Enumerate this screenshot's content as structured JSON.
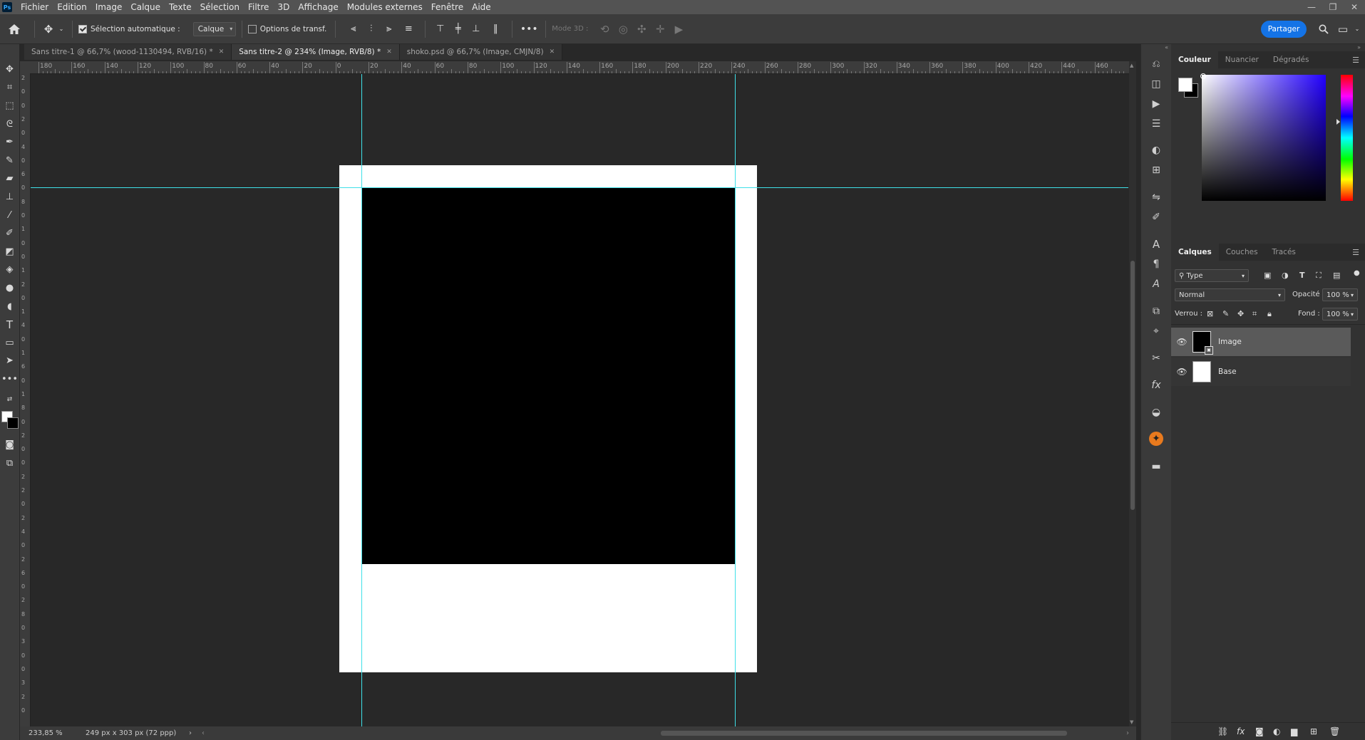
{
  "app": {
    "logo": "Ps"
  },
  "menu": [
    "Fichier",
    "Edition",
    "Image",
    "Calque",
    "Texte",
    "Sélection",
    "Filtre",
    "3D",
    "Affichage",
    "Modules externes",
    "Fenêtre",
    "Aide"
  ],
  "options": {
    "auto_select_label": "Sélection automatique :",
    "auto_select_value": "Calque",
    "transform_label": "Options de transf.",
    "mode3d_label": "Mode 3D :",
    "share_label": "Partager"
  },
  "tabs": [
    {
      "label": "Sans titre-1 @ 66,7% (wood-1130494, RVB/16) *",
      "active": false
    },
    {
      "label": "Sans titre-2 @ 234% (Image, RVB/8) *",
      "active": true
    },
    {
      "label": "shoko.psd @ 66,7% (Image, CMJN/8)",
      "active": false
    }
  ],
  "ruler_top_labels": [
    "180",
    "160",
    "140",
    "120",
    "100",
    "80",
    "60",
    "40",
    "20",
    "0",
    "20",
    "40",
    "60",
    "80",
    "100",
    "120",
    "140",
    "160",
    "180",
    "200",
    "220",
    "240",
    "260",
    "280",
    "300",
    "320",
    "340",
    "360",
    "380",
    "400",
    "420",
    "440",
    "460"
  ],
  "ruler_left_labels": [
    "2",
    "0",
    "0",
    "2",
    "0",
    "4",
    "0",
    "6",
    "0",
    "8",
    "0",
    "1",
    "0",
    "0",
    "1",
    "2",
    "0",
    "1",
    "4",
    "0",
    "1",
    "6",
    "0",
    "1",
    "8",
    "0",
    "2",
    "0",
    "0",
    "2",
    "2",
    "0",
    "2",
    "4",
    "0",
    "2",
    "6",
    "0",
    "2",
    "8",
    "0",
    "3",
    "0",
    "0",
    "3",
    "2",
    "0"
  ],
  "status": {
    "zoom": "233,85 %",
    "doc_info": "249 px x 303 px (72 ppp)"
  },
  "color_panel": {
    "tabs": [
      "Couleur",
      "Nuancier",
      "Dégradés"
    ],
    "fg_color": "#ffffff",
    "bg_color": "#000000",
    "hue_color": "#2200ff"
  },
  "layers_panel": {
    "tabs": [
      "Calques",
      "Couches",
      "Tracés"
    ],
    "filter_type": "Type",
    "blend_mode": "Normal",
    "opacity_label": "Opacité :",
    "opacity_value": "100 %",
    "lock_label": "Verrou :",
    "fill_label": "Fond :",
    "fill_value": "100 %",
    "layers": [
      {
        "name": "Image",
        "selected": true
      },
      {
        "name": "Base",
        "selected": false
      }
    ]
  }
}
